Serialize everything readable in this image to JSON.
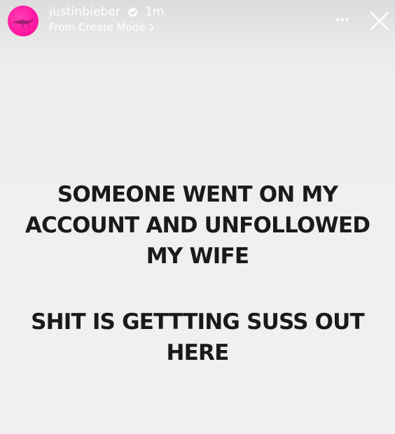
{
  "story_header": {
    "username": "justinbieber",
    "time_ago": "1m",
    "source_label": "From Create Mode",
    "avatar_icon": "avatar-image",
    "verified_icon": "verified-badge-icon",
    "more_icon": "more-options-icon",
    "close_icon": "close-icon"
  },
  "story_text": {
    "block1": [
      "SOMEONE WENT ON MY",
      "ACCOUNT AND UNFOLLOWED",
      "MY WIFE"
    ],
    "block2": [
      "SHIT IS GETTTING SUSS OUT",
      "HERE"
    ]
  },
  "colors": {
    "avatar": "#ff1aa3",
    "text": "#1a1a1a",
    "header_text": "#ffffff",
    "background": "#f0f0f0"
  }
}
